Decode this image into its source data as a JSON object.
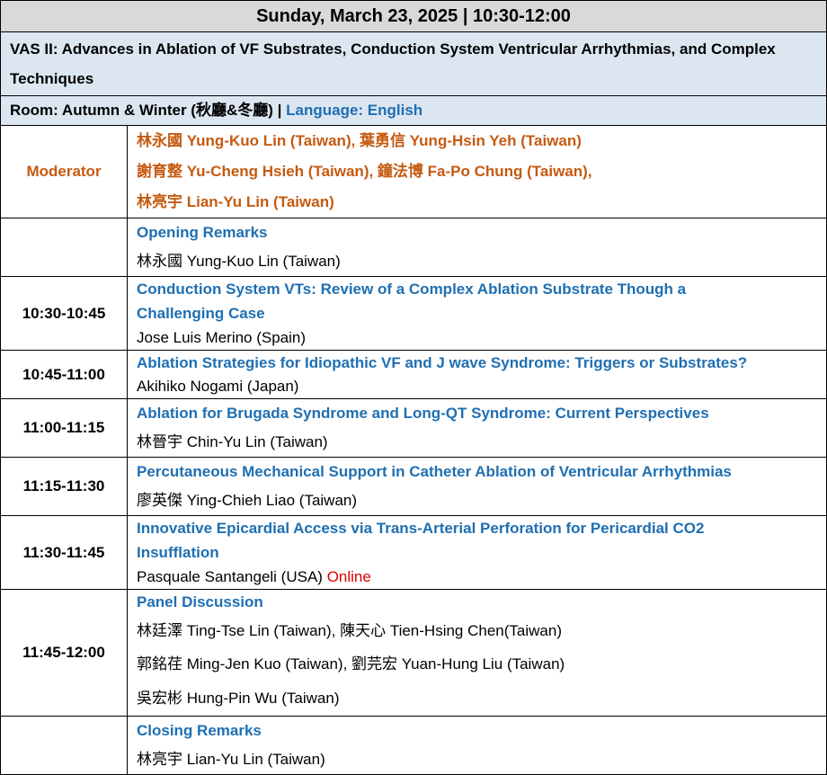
{
  "header": "Sunday, March 23, 2025 | 10:30-12:00",
  "session_title": "VAS II: Advances in Ablation of VF Substrates, Conduction System Ventricular Arrhythmias, and Complex Techniques",
  "room": {
    "label": "Room: Autumn & Winter (秋廳&冬廳) |",
    "language": "Language: English"
  },
  "moderator": {
    "label": "Moderator",
    "lines": [
      "林永國 Yung-Kuo Lin (Taiwan), 葉勇信 Yung-Hsin Yeh (Taiwan)",
      "謝育整 Yu-Cheng Hsieh (Taiwan), 鐘法博 Fa-Po Chung (Taiwan),",
      "林亮宇 Lian-Yu Lin (Taiwan)"
    ]
  },
  "rows": [
    {
      "time": "",
      "title": [
        "Opening Remarks"
      ],
      "speaker": [
        "林永國 Yung-Kuo Lin (Taiwan)"
      ]
    },
    {
      "time": "10:30-10:45",
      "title": [
        "Conduction System VTs: Review of a Complex Ablation Substrate Though a",
        "Challenging Case"
      ],
      "speaker": [
        "Jose Luis Merino (Spain)"
      ]
    },
    {
      "time": "10:45-11:00",
      "title": [
        "Ablation Strategies for Idiopathic VF and J wave Syndrome: Triggers or Substrates?"
      ],
      "speaker": [
        "Akihiko Nogami (Japan)"
      ]
    },
    {
      "time": "11:00-11:15",
      "title": [
        "Ablation for Brugada Syndrome and Long-QT Syndrome: Current Perspectives"
      ],
      "speaker": [
        "林晉宇 Chin-Yu Lin (Taiwan)"
      ]
    },
    {
      "time": "11:15-11:30",
      "title": [
        "Percutaneous Mechanical Support in Catheter Ablation of Ventricular Arrhythmias"
      ],
      "speaker": [
        "廖英傑 Ying-Chieh Liao (Taiwan)"
      ]
    },
    {
      "time": "11:30-11:45",
      "title": [
        "Innovative Epicardial Access via Trans-Arterial Perforation for Pericardial CO2",
        "Insufflation"
      ],
      "speaker": [
        "Pasquale Santangeli (USA)"
      ],
      "online": "Online"
    },
    {
      "time": "11:45-12:00",
      "title": [
        "Panel Discussion"
      ],
      "speaker": [
        "林廷澤 Ting-Tse Lin (Taiwan), 陳天心 Tien-Hsing Chen(Taiwan)",
        "郭銘荏 Ming-Jen Kuo (Taiwan), 劉芫宏 Yuan-Hung Liu (Taiwan)",
        "吳宏彬 Hung-Pin Wu (Taiwan)"
      ]
    },
    {
      "time": "",
      "title": [
        "Closing Remarks"
      ],
      "speaker": [
        "林亮宇 Lian-Yu Lin (Taiwan)"
      ]
    }
  ],
  "colors": {
    "header_bg": "#d9d9d9",
    "band_bg": "#dce6f1",
    "title_blue": "#1f6fb2",
    "moderator_orange": "#c55a11",
    "online_red": "#e00000"
  }
}
